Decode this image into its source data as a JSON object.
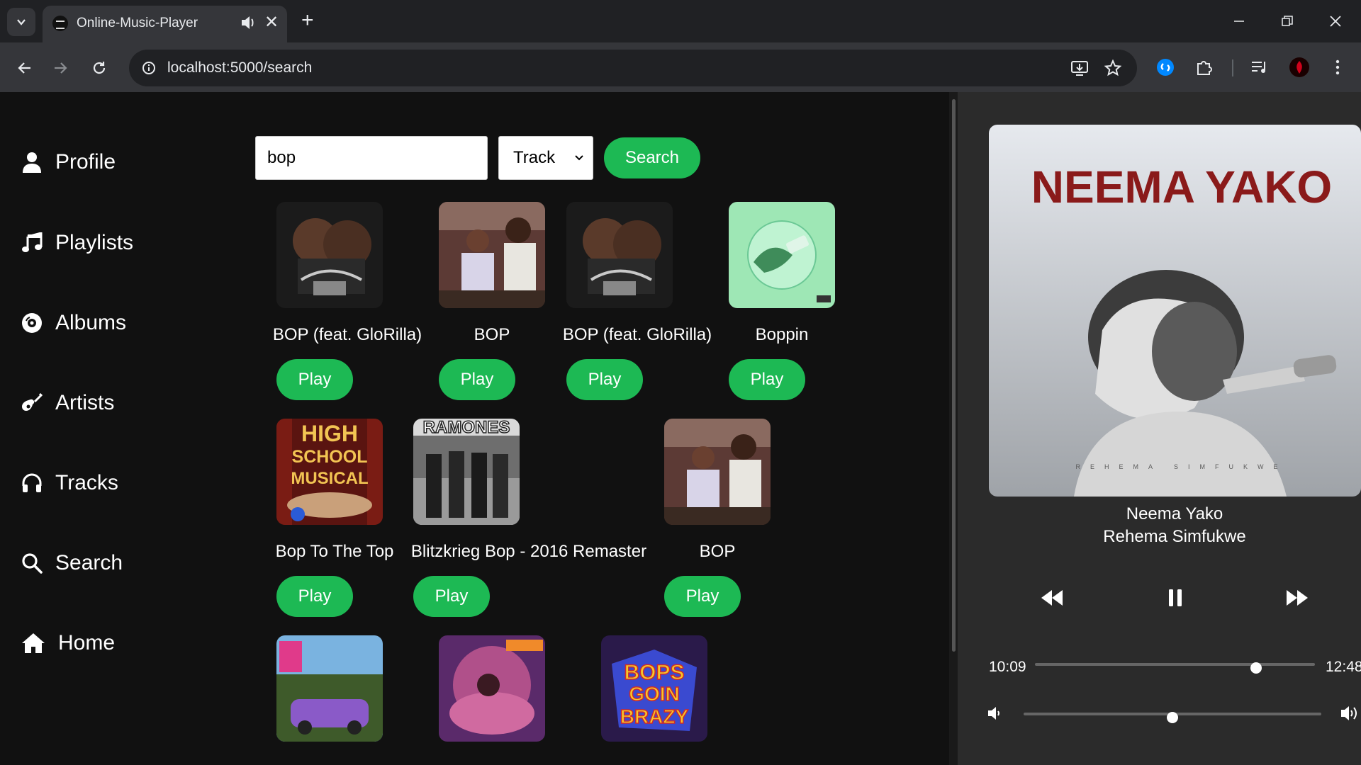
{
  "browser": {
    "tab_title": "Online-Music-Player",
    "url": "localhost:5000/search"
  },
  "sidebar": {
    "items": [
      {
        "label": "Profile",
        "icon": "user-icon"
      },
      {
        "label": "Playlists",
        "icon": "music-note-icon"
      },
      {
        "label": "Albums",
        "icon": "disc-icon"
      },
      {
        "label": "Artists",
        "icon": "guitar-icon"
      },
      {
        "label": "Tracks",
        "icon": "headphones-icon"
      },
      {
        "label": "Search",
        "icon": "search-icon"
      },
      {
        "label": "Home",
        "icon": "home-icon"
      }
    ]
  },
  "search": {
    "query": "bop",
    "type_selected": "Track",
    "button_label": "Search"
  },
  "results": [
    {
      "title": "BOP (feat. GloRilla)",
      "play_label": "Play",
      "cover": "dark-duo"
    },
    {
      "title": "BOP",
      "play_label": "Play",
      "cover": "baby-photo"
    },
    {
      "title": "BOP (feat. GloRilla)",
      "play_label": "Play",
      "cover": "dark-duo"
    },
    {
      "title": "Boppin",
      "play_label": "Play",
      "cover": "mint-bubble"
    },
    {
      "title": "Bop To The Top",
      "play_label": "Play",
      "cover": "high-school-musical",
      "cover_text": "HIGH SCHOOL MUSICAL"
    },
    {
      "title": "Blitzkrieg Bop - 2016 Remaster",
      "play_label": "Play",
      "cover": "ramones",
      "cover_text": "RAMONES"
    },
    {
      "title": "BOP",
      "play_label": "Play",
      "cover": "baby-photo"
    },
    {
      "title": "",
      "cover": "purple-car"
    },
    {
      "title": "",
      "cover": "purple-pink"
    },
    {
      "title": "",
      "cover": "bops-goin-brazy",
      "cover_text": "BOPS GOIN BRAZY"
    }
  ],
  "player": {
    "title": "Neema Yako",
    "artist": "Rehema Simfukwe",
    "art_title": "NEEMA YAKO",
    "art_subtitle": "REHEMA SIMFUKWE",
    "elapsed": "10:09",
    "duration": "12:48",
    "progress_fraction": 0.79,
    "volume_fraction": 0.5
  },
  "colors": {
    "accent": "#1db954",
    "background": "#111111",
    "player_bg": "#2b2b2b"
  }
}
